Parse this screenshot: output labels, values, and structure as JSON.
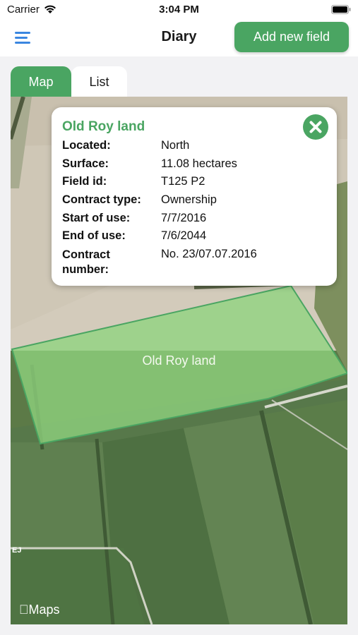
{
  "status_bar": {
    "carrier": "Carrier",
    "time": "3:04 PM"
  },
  "nav": {
    "title": "Diary",
    "add_button": "Add new field"
  },
  "tabs": [
    {
      "label": "Map"
    },
    {
      "label": "List"
    }
  ],
  "popup": {
    "title": "Old Roy land",
    "rows": [
      {
        "label": "Located:",
        "value": "North"
      },
      {
        "label": "Surface:",
        "value": "11.08 hectares"
      },
      {
        "label": "Field id:",
        "value": "T125 P2"
      },
      {
        "label": "Contract type:",
        "value": "Ownership"
      },
      {
        "label": "Start of use:",
        "value": "7/7/2016"
      },
      {
        "label": "End of use:",
        "value": "7/6/2044"
      },
      {
        "label": "Contract number:",
        "value": "No. 23/07.07.2016"
      }
    ]
  },
  "map": {
    "field_label": "Old Roy land",
    "attribution": "Maps",
    "legal_mark": "EJ",
    "field_color": "#8fd37f"
  },
  "colors": {
    "accent": "#4aa562"
  }
}
